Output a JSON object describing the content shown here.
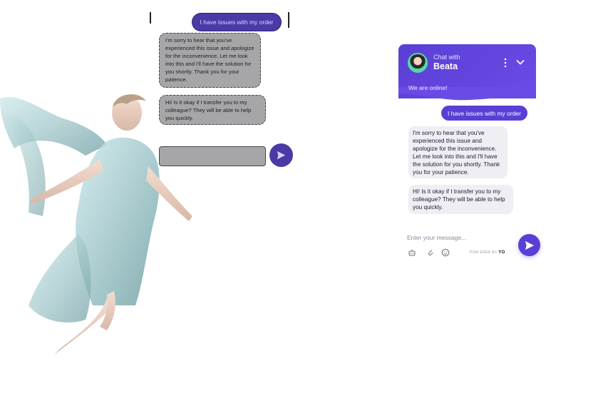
{
  "colors": {
    "brand": "#5b3fd4",
    "user_bubble": "#5a3fd6",
    "bot_bubble": "#eeeef3",
    "online_ring": "#53d8a8"
  },
  "collage": {
    "user_message": "I have issues with my order",
    "bot_message_1": "I'm sorry to hear that you've experienced this issue and apologize for the inconvenience. Let me look into this and I'll have the solution for you shortly. Thank you for your patience.",
    "bot_message_2": "Hi! Is it okay if I transfer you to my colleague? They will be able to help you quickly."
  },
  "widget": {
    "header": {
      "chat_with": "Chat with",
      "agent_name": "Beata",
      "status": "We are online!"
    },
    "messages": [
      {
        "from": "user",
        "text": "I have issues with my order"
      },
      {
        "from": "bot",
        "text": "I'm sorry to hear that you've experienced this issue and apologize for the inconvenience. Let me look into this and I'll have the solution for you shortly. Thank you for your patience."
      },
      {
        "from": "bot",
        "text": "Hi! Is it okay if I transfer you to my colleague? They will be able to help you quickly."
      }
    ],
    "input": {
      "placeholder": "Enter your message..."
    },
    "powered_by": {
      "label": "POW ERED BY",
      "brand": "YO"
    },
    "icons": [
      "bot-icon",
      "attachment-icon",
      "emoji-icon",
      "send-icon",
      "more-options-icon",
      "chevron-down-icon"
    ]
  }
}
